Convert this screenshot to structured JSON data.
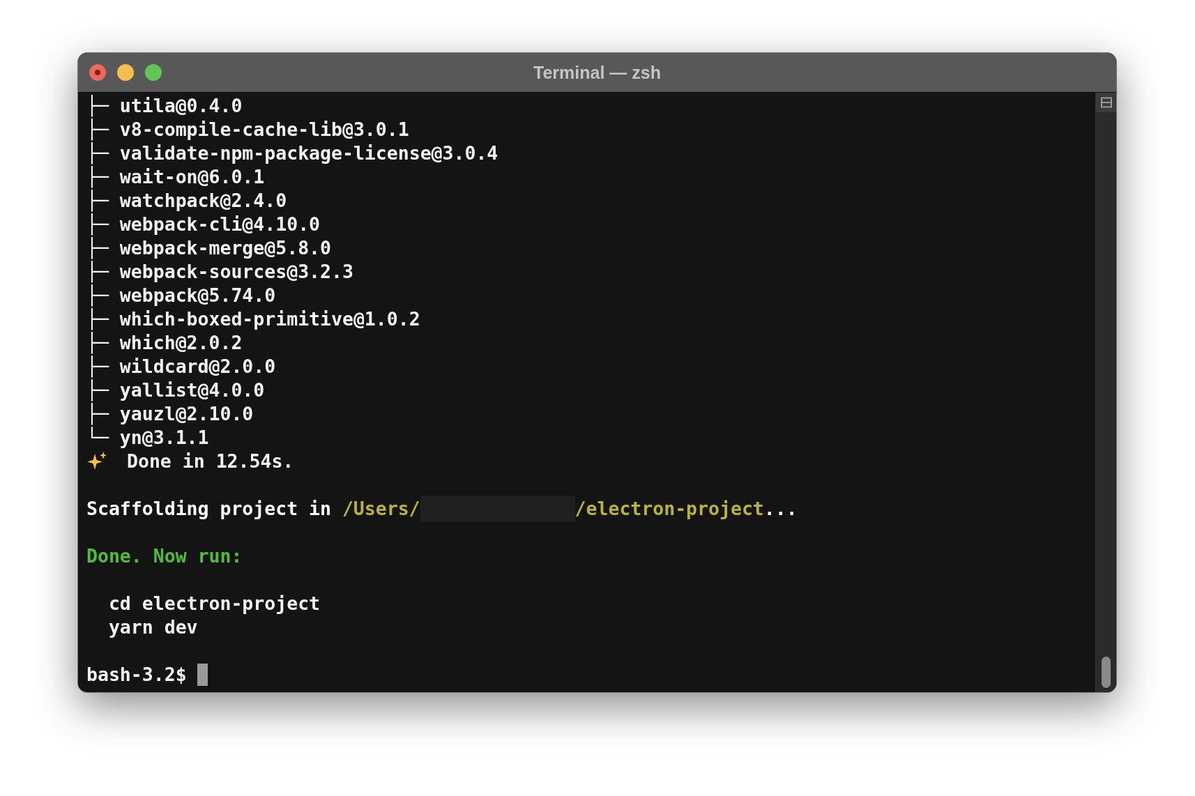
{
  "window": {
    "title": "Terminal — zsh"
  },
  "lines": [
    {
      "kind": "text",
      "text": "├─ utila@0.4.0"
    },
    {
      "kind": "text",
      "text": "├─ v8-compile-cache-lib@3.0.1"
    },
    {
      "kind": "text",
      "text": "├─ validate-npm-package-license@3.0.4"
    },
    {
      "kind": "text",
      "text": "├─ wait-on@6.0.1"
    },
    {
      "kind": "text",
      "text": "├─ watchpack@2.4.0"
    },
    {
      "kind": "text",
      "text": "├─ webpack-cli@4.10.0"
    },
    {
      "kind": "text",
      "text": "├─ webpack-merge@5.8.0"
    },
    {
      "kind": "text",
      "text": "├─ webpack-sources@3.2.3"
    },
    {
      "kind": "text",
      "text": "├─ webpack@5.74.0"
    },
    {
      "kind": "text",
      "text": "├─ which-boxed-primitive@1.0.2"
    },
    {
      "kind": "text",
      "text": "├─ which@2.0.2"
    },
    {
      "kind": "text",
      "text": "├─ wildcard@2.0.0"
    },
    {
      "kind": "text",
      "text": "├─ yallist@4.0.0"
    },
    {
      "kind": "text",
      "text": "├─ yauzl@2.10.0"
    },
    {
      "kind": "text",
      "text": "└─ yn@3.1.1"
    },
    {
      "kind": "done",
      "text": "Done in 12.54s."
    },
    {
      "kind": "blank"
    },
    {
      "kind": "segments",
      "segments": [
        {
          "kind": "text",
          "text": "Scaffolding project in",
          "color": "#ffffff"
        },
        {
          "kind": "text",
          "text": "/Users/",
          "color": "#b9b23c"
        },
        {
          "kind": "redacted"
        },
        {
          "kind": "text",
          "text": "/electron-project",
          "color": "#b9b23c"
        },
        {
          "kind": "text",
          "text": "...",
          "color": "#ffffff"
        }
      ]
    },
    {
      "kind": "blank"
    },
    {
      "kind": "text",
      "text": "Done. Now run:",
      "color": "#4fbf3a"
    },
    {
      "kind": "blank"
    },
    {
      "kind": "text",
      "text": "  cd electron-project"
    },
    {
      "kind": "text",
      "text": "  yarn dev"
    },
    {
      "kind": "blank"
    },
    {
      "kind": "prompt",
      "text": "bash-3.2$"
    }
  ]
}
